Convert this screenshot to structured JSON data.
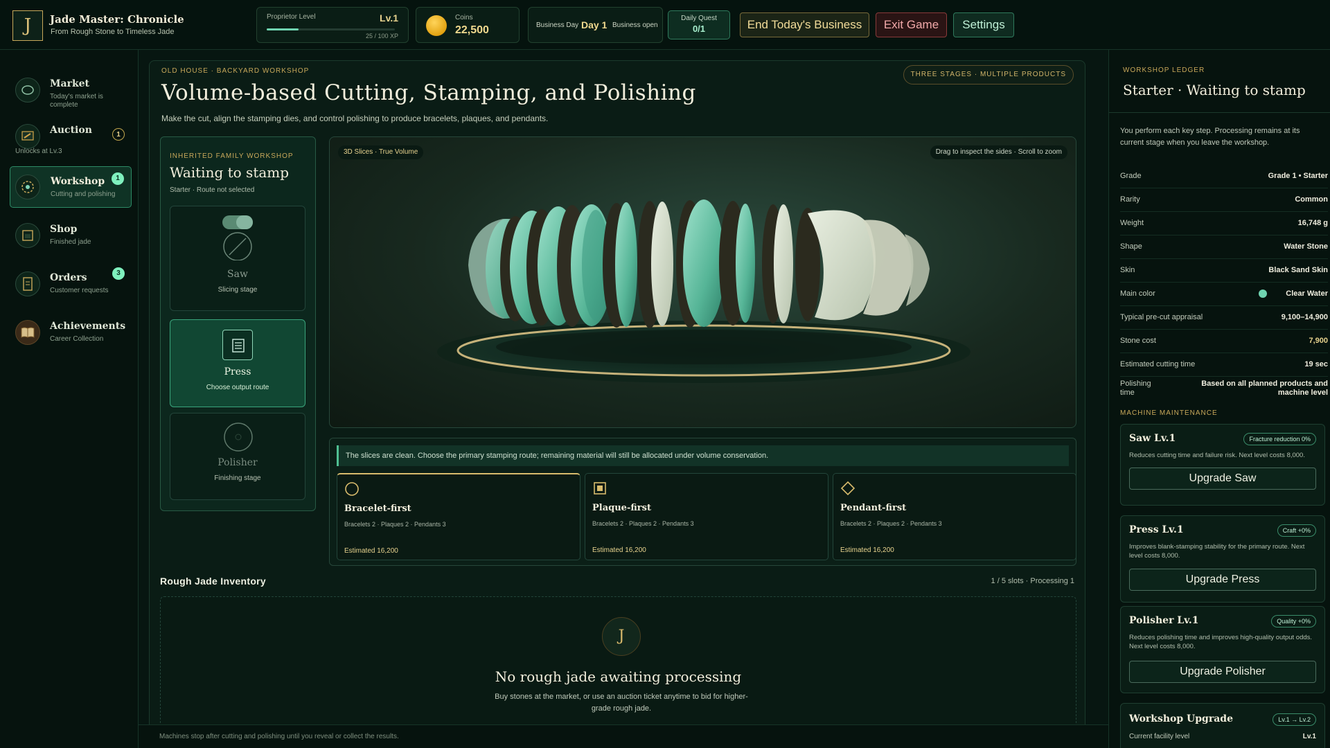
{
  "app": {
    "logo": "J",
    "title": "Jade Master: Chronicle",
    "subtitle": "From Rough Stone to Timeless Jade"
  },
  "topbar": {
    "level_label": "Proprietor Level",
    "level_value": "Lv.1",
    "xp_text": "25 / 100 XP",
    "xp_fraction": 0.25,
    "coins_label": "Coins",
    "coins_value": "22,500",
    "day_label": "Business Day",
    "day_value": "Day 1",
    "day_status": "Business open",
    "quest_label": "Daily Quest",
    "quest_value": "0/1",
    "end_label": "End Today's Business",
    "exit_label": "Exit Game",
    "settings_label": "Settings"
  },
  "sidebar": {
    "items": [
      {
        "label": "Market",
        "sub": "Today's market is complete",
        "icon": "market-icon"
      },
      {
        "label": "Auction",
        "sub": "Unlocks at Lv.3",
        "badge": "1",
        "icon": "gavel-icon"
      },
      {
        "label": "Workshop",
        "sub": "Cutting and polishing",
        "badge": "1",
        "icon": "gear-icon"
      },
      {
        "label": "Shop",
        "sub": "Finished jade",
        "icon": "shop-icon"
      },
      {
        "label": "Orders",
        "sub": "Customer requests",
        "badge": "3",
        "icon": "scroll-icon"
      },
      {
        "label": "Achievements",
        "sub": "Career Collection",
        "icon": "book-icon"
      }
    ]
  },
  "main": {
    "kicker": "OLD HOUSE · BACKYARD WORKSHOP",
    "title": "Volume-based Cutting, Stamping, and Polishing",
    "description": "Make the cut, align the stamping dies, and control polishing to produce bracelets, plaques, and pendants.",
    "stage_pill": "THREE STAGES · MULTIPLE PRODUCTS",
    "panel": {
      "kicker": "INHERITED FAMILY WORKSHOP",
      "title": "Waiting to stamp",
      "sub": "Starter · Route not selected",
      "stages": [
        {
          "name": "Saw",
          "desc": "Slicing stage"
        },
        {
          "name": "Press",
          "desc": "Choose output route"
        },
        {
          "name": "Polisher",
          "desc": "Finishing stage"
        }
      ]
    },
    "viewer": {
      "tag": "3D Slices · True Volume",
      "hint": "Drag to inspect the sides · Scroll to zoom"
    },
    "route": {
      "note": "The slices are clean. Choose the primary stamping route; remaining material will still be allocated under volume conservation.",
      "options": [
        {
          "title": "Bracelet-first",
          "sub": "Bracelets 2 · Plaques 2 · Pendants 3",
          "estimate": "Estimated 16,200"
        },
        {
          "title": "Plaque-first",
          "sub": "Bracelets 2 · Plaques 2 · Pendants 3",
          "estimate": "Estimated 16,200"
        },
        {
          "title": "Pendant-first",
          "sub": "Bracelets 2 · Plaques 2 · Pendants 3",
          "estimate": "Estimated 16,200"
        }
      ]
    },
    "inventory": {
      "title": "Rough Jade Inventory",
      "meta": "1 / 5 slots · Processing 1",
      "icon": "J",
      "empty_title": "No rough jade awaiting processing",
      "empty_text": "Buy stones at the market, or use an auction ticket anytime to bid for higher-grade rough jade."
    },
    "footer": "Machines stop after cutting and polishing until you reveal or collect the results."
  },
  "ledger": {
    "kicker": "WORKSHOP LEDGER",
    "title": "Starter · Waiting to stamp",
    "description": "You perform each key step. Processing remains at its current stage when you leave the workshop.",
    "rows": [
      {
        "k": "Grade",
        "v": "Grade 1 • Starter"
      },
      {
        "k": "Rarity",
        "v": "Common"
      },
      {
        "k": "Weight",
        "v": "16,748 g"
      },
      {
        "k": "Shape",
        "v": "Water Stone"
      },
      {
        "k": "Skin",
        "v": "Black Sand Skin"
      },
      {
        "k": "Main color",
        "v": "Clear Water"
      },
      {
        "k": "Typical pre-cut appraisal",
        "v": "9,100–14,900"
      },
      {
        "k": "Stone cost",
        "v": "7,900"
      },
      {
        "k": "Estimated cutting time",
        "v": "19 sec"
      },
      {
        "k": "Polishing time",
        "v": "Based on all planned products and machine level"
      }
    ],
    "maintenance_title": "MACHINE MAINTENANCE",
    "machines": [
      {
        "title": "Saw Lv.1",
        "pill": "Fracture reduction 0%",
        "desc": "Reduces cutting time and failure risk. Next level costs 8,000.",
        "button": "Upgrade Saw"
      },
      {
        "title": "Press Lv.1",
        "pill": "Craft +0%",
        "desc": "Improves blank-stamping stability for the primary route. Next level costs 8,000.",
        "button": "Upgrade Press"
      },
      {
        "title": "Polisher Lv.1",
        "pill": "Quality +0%",
        "desc": "Reduces polishing time and improves high-quality output odds. Next level costs 8,000.",
        "button": "Upgrade Polisher"
      }
    ],
    "upgrade": {
      "title": "Workshop Upgrade",
      "pill": "Lv.1 → Lv.2",
      "k": "Current facility level",
      "v": "Lv.1"
    }
  },
  "colors": {
    "accent_green": "#4fbf92",
    "gold": "#c8a85a",
    "jade": "#7fd6b8",
    "danger": "#8a3a3a"
  }
}
